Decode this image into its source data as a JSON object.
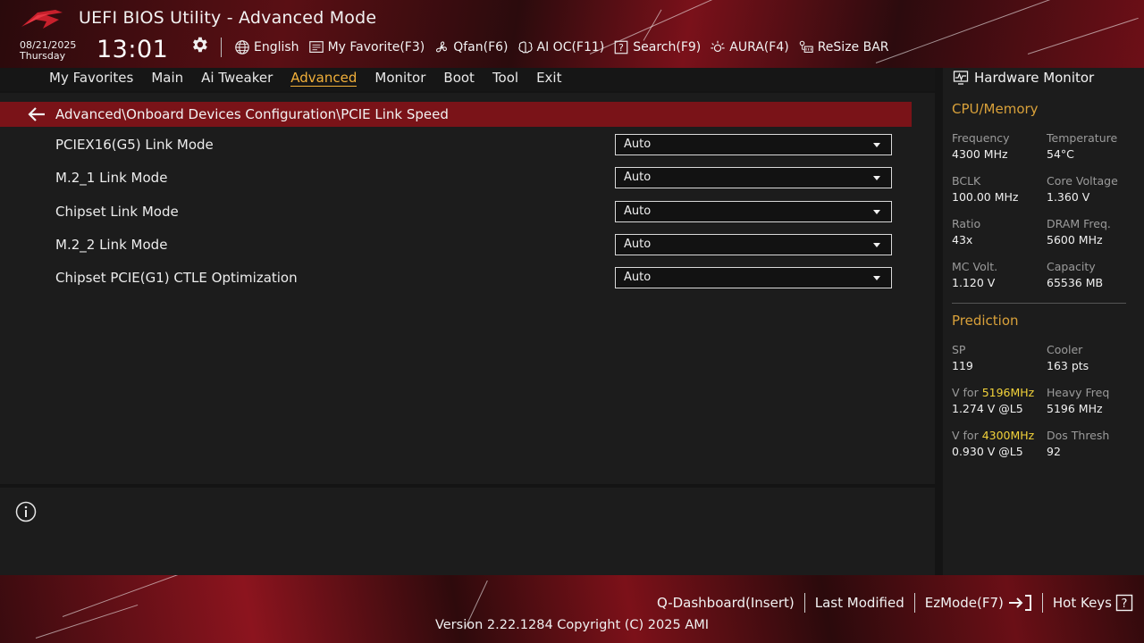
{
  "header": {
    "title": "UEFI BIOS Utility - Advanced Mode",
    "date": "08/21/2025",
    "day": "Thursday",
    "time": "13:01",
    "tools": [
      {
        "label": "English",
        "icon": "globe-icon"
      },
      {
        "label": "My Favorite(F3)",
        "icon": "favorite-list-icon"
      },
      {
        "label": "Qfan(F6)",
        "icon": "fan-icon"
      },
      {
        "label": "AI OC(F11)",
        "icon": "ai-brain-icon"
      },
      {
        "label": "Search(F9)",
        "icon": "search-question-icon"
      },
      {
        "label": "AURA(F4)",
        "icon": "aura-light-icon"
      },
      {
        "label": "ReSize BAR",
        "icon": "resize-bar-icon"
      }
    ]
  },
  "menu": {
    "items": [
      "My Favorites",
      "Main",
      "Ai Tweaker",
      "Advanced",
      "Monitor",
      "Boot",
      "Tool",
      "Exit"
    ],
    "active": "Advanced"
  },
  "breadcrumb": "Advanced\\Onboard Devices Configuration\\PCIE Link Speed",
  "settings": [
    {
      "label": "PCIEX16(G5) Link Mode",
      "value": "Auto"
    },
    {
      "label": "M.2_1 Link Mode",
      "value": "Auto"
    },
    {
      "label": "Chipset Link Mode",
      "value": "Auto"
    },
    {
      "label": "M.2_2 Link Mode",
      "value": "Auto"
    },
    {
      "label": "Chipset PCIE(G1) CTLE Optimization",
      "value": "Auto"
    }
  ],
  "hardware_monitor": {
    "title": "Hardware Monitor",
    "cpu_memory": {
      "title": "CPU/Memory",
      "frequency": {
        "label": "Frequency",
        "value": "4300 MHz"
      },
      "temperature": {
        "label": "Temperature",
        "value": "54°C"
      },
      "bclk": {
        "label": "BCLK",
        "value": "100.00 MHz"
      },
      "core_voltage": {
        "label": "Core Voltage",
        "value": "1.360 V"
      },
      "ratio": {
        "label": "Ratio",
        "value": "43x"
      },
      "dram_freq": {
        "label": "DRAM Freq.",
        "value": "5600 MHz"
      },
      "mc_volt": {
        "label": "MC Volt.",
        "value": "1.120 V"
      },
      "capacity": {
        "label": "Capacity",
        "value": "65536 MB"
      }
    },
    "prediction": {
      "title": "Prediction",
      "sp": {
        "label": "SP",
        "value": "119"
      },
      "cooler": {
        "label": "Cooler",
        "value": "163 pts"
      },
      "v_for_1": {
        "prefix": "V for ",
        "freq": "5196MHz",
        "value": "1.274 V @L5"
      },
      "heavy_freq": {
        "label": "Heavy Freq",
        "value": "5196 MHz"
      },
      "v_for_2": {
        "prefix": "V for ",
        "freq": "4300MHz",
        "value": "0.930 V @L5"
      },
      "dos_thresh": {
        "label": "Dos Thresh",
        "value": "92"
      }
    }
  },
  "footer": {
    "links": [
      "Q-Dashboard(Insert)",
      "Last Modified",
      "EzMode(F7)",
      "Hot Keys"
    ],
    "version": "Version 2.22.1284 Copyright (C) 2025 AMI"
  },
  "colors": {
    "accent": "#f2b03a",
    "breadcrumb_bg": "#7a1318",
    "highlight": "#f2d23a"
  }
}
